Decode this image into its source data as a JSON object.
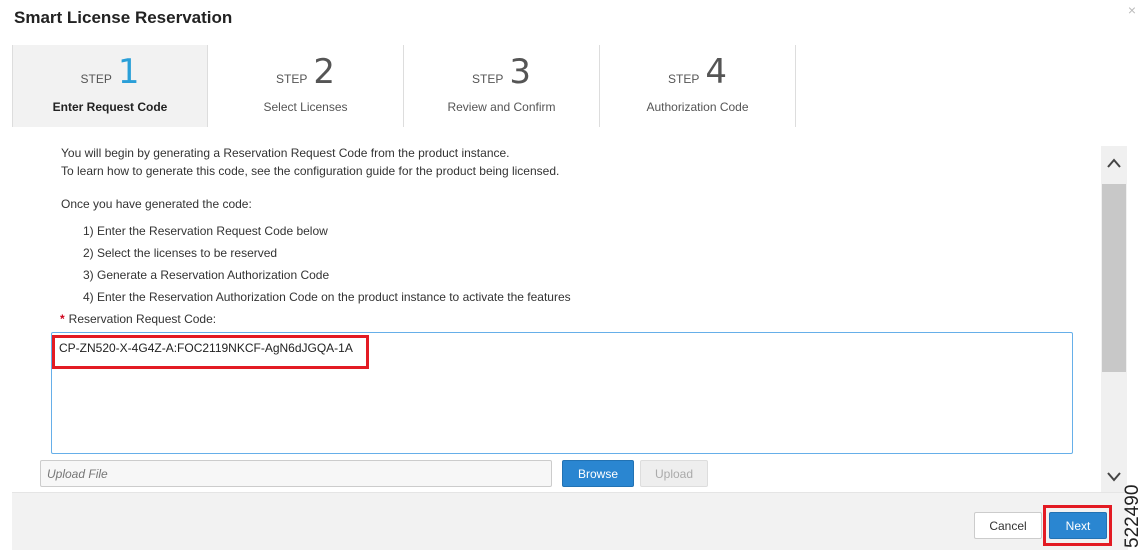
{
  "dialog": {
    "title": "Smart License Reservation",
    "close_icon": "×"
  },
  "steps": [
    {
      "word": "STEP",
      "number": "1",
      "label": "Enter Request Code",
      "active": true
    },
    {
      "word": "STEP",
      "number": "2",
      "label": "Select Licenses",
      "active": false
    },
    {
      "word": "STEP",
      "number": "3",
      "label": "Review and Confirm",
      "active": false
    },
    {
      "word": "STEP",
      "number": "4",
      "label": "Authorization Code",
      "active": false
    }
  ],
  "content": {
    "intro_line1": "You will begin by generating a Reservation Request Code from the product instance.",
    "intro_line2": "To learn how to generate this code, see the configuration guide for the product being licensed.",
    "once_text": "Once you have generated the code:",
    "list": [
      "1) Enter the Reservation Request Code below",
      "2) Select the licenses to be reserved",
      "3) Generate a Reservation Authorization Code",
      "4) Enter the Reservation Authorization Code on the product instance to activate the features"
    ],
    "request_label": "Reservation Request Code:",
    "required_marker": "*",
    "request_code": "CP-ZN520-X-4G4Z-A:FOC2119NKCF-AgN6dJGQA-1A"
  },
  "upload": {
    "placeholder": "Upload File",
    "browse_label": "Browse",
    "upload_label": "Upload"
  },
  "scrollbar": {
    "up_icon": "^",
    "down_icon": "v"
  },
  "footer": {
    "cancel_label": "Cancel",
    "next_label": "Next"
  },
  "figure_id": "522490",
  "colors": {
    "accent": "#2a86d1",
    "step_active": "#2a9fd8",
    "highlight": "#e31b23",
    "required": "#d0021b"
  }
}
